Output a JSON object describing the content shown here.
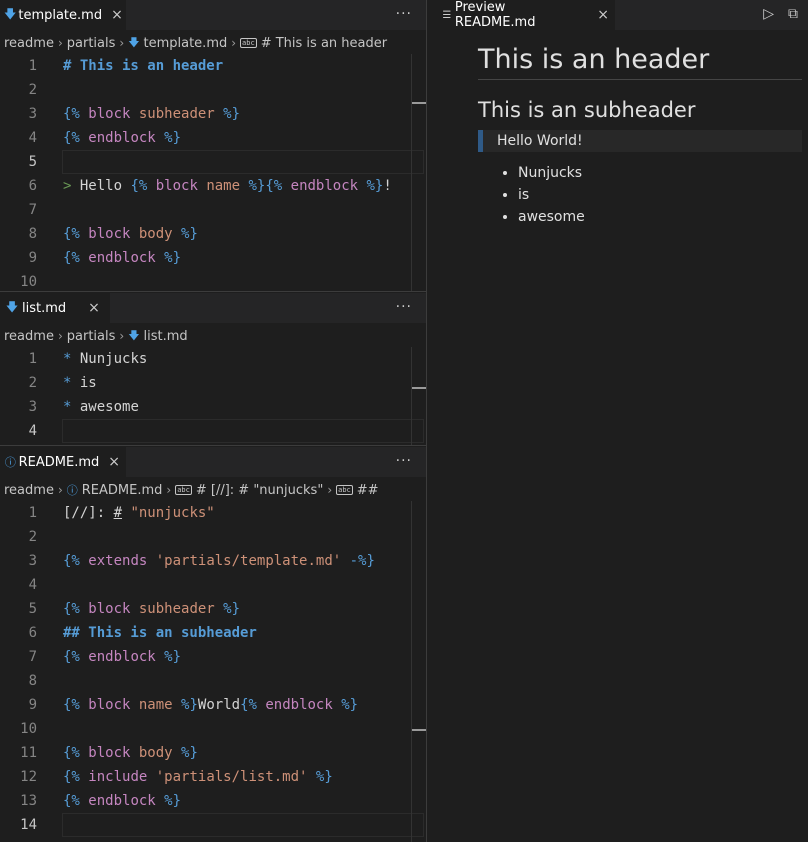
{
  "panes": {
    "template": {
      "tab": {
        "title": "template.md",
        "icon": "markdown-arrow-icon",
        "close": "×"
      },
      "more": "···",
      "breadcrumb": {
        "folder": "readme",
        "sub": "partials",
        "file": "template.md",
        "symbol": "# This is an header"
      },
      "lines": [
        "1",
        "2",
        "3",
        "4",
        "5",
        "6",
        "7",
        "8",
        "9",
        "10"
      ],
      "code": {
        "l1": "# This is an header",
        "l3a": "{% ",
        "l3b": "block",
        "l3c": " subheader",
        "l3d": " %}",
        "l4a": "{% ",
        "l4b": "endblock",
        "l4c": " %}",
        "l6q": "> ",
        "l6t": "Hello ",
        "l6a": "{% ",
        "l6b": "block",
        "l6c": " name",
        "l6d": " %}",
        "l6e": "{% ",
        "l6f": "endblock",
        "l6g": " %}",
        "l6h": "!",
        "l8a": "{% ",
        "l8b": "block",
        "l8c": " body",
        "l8d": " %}",
        "l9a": "{% ",
        "l9b": "endblock",
        "l9c": " %}"
      }
    },
    "list": {
      "tab": {
        "title": "list.md",
        "close": "×"
      },
      "more": "···",
      "breadcrumb": {
        "folder": "readme",
        "sub": "partials",
        "file": "list.md"
      },
      "lines": [
        "1",
        "2",
        "3",
        "4"
      ],
      "bullet": "*",
      "items": [
        "Nunjucks",
        "is",
        "awesome"
      ]
    },
    "readme": {
      "tab": {
        "title": "README.md",
        "icon": "info-icon",
        "close": "×"
      },
      "more": "···",
      "breadcrumb": {
        "folder": "readme",
        "file": "README.md",
        "symbol1": "# [//]: # \"nunjucks\"",
        "symbol2": "##"
      },
      "lines": [
        "1",
        "2",
        "3",
        "4",
        "5",
        "6",
        "7",
        "8",
        "9",
        "10",
        "11",
        "12",
        "13",
        "14"
      ],
      "code": {
        "l1a": "[//]: ",
        "l1b": "#",
        "l1c": " \"nunjucks\"",
        "l3a": "{% ",
        "l3b": "extends",
        "l3c": " 'partials/template.md'",
        "l3d": " -%}",
        "l5a": "{% ",
        "l5b": "block",
        "l5c": " subheader",
        "l5d": " %}",
        "l6": "## This is an subheader",
        "l7a": "{% ",
        "l7b": "endblock",
        "l7c": " %}",
        "l9a": "{% ",
        "l9b": "block",
        "l9c": " name",
        "l9d": " %}",
        "l9e": "World",
        "l9f": "{% ",
        "l9g": "endblock",
        "l9h": " %}",
        "l11a": "{% ",
        "l11b": "block",
        "l11c": " body",
        "l11d": " %}",
        "l12a": "{% ",
        "l12b": "include",
        "l12c": " 'partials/list.md'",
        "l12d": " %}",
        "l13a": "{% ",
        "l13b": "endblock",
        "l13c": " %}"
      }
    }
  },
  "preview": {
    "tab": {
      "title": "Preview README.md",
      "icon": "preview-lines-icon",
      "close": "×"
    },
    "h1": "This is an header",
    "h2": "This is an subheader",
    "quote": "Hello World!",
    "list": [
      "Nunjucks",
      "is",
      "awesome"
    ]
  },
  "colors": {
    "accent": "#4fa3e6",
    "keyword": "#c586c0",
    "delimiter": "#569cd6",
    "string": "#ce9178",
    "quote": "#6a9955"
  }
}
